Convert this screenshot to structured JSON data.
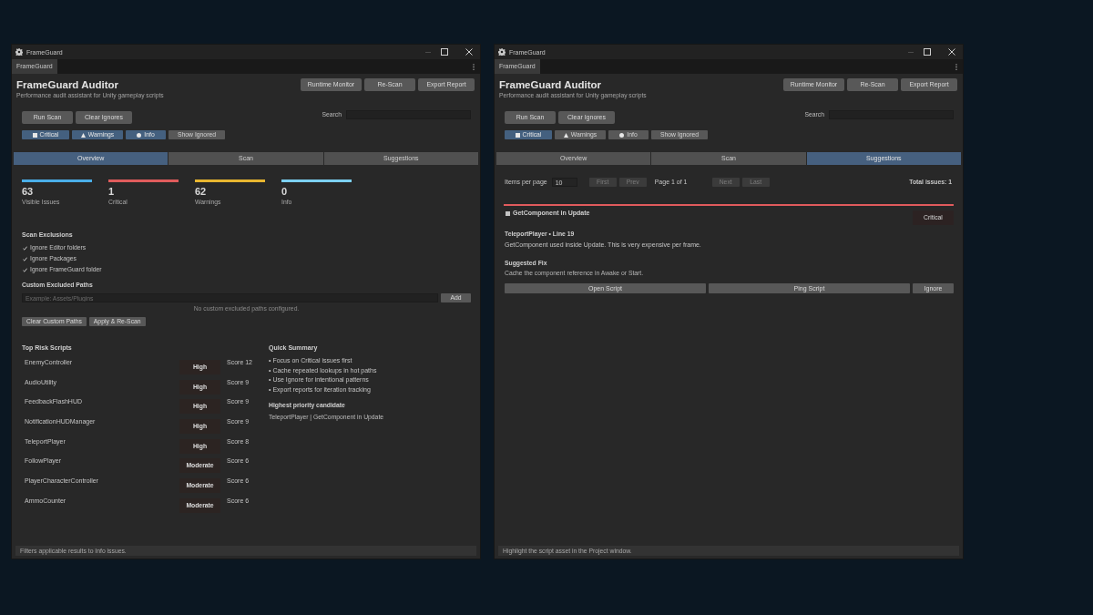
{
  "windows": [
    {
      "title": "FrameGuard",
      "tab": "FrameGuard",
      "header": {
        "title": "FrameGuard Auditor",
        "subtitle": "Performance audit assistant for Unity gameplay scripts",
        "buttons": [
          "Runtime Monitor",
          "Re-Scan",
          "Export Report"
        ]
      },
      "toolbar": {
        "buttons": [
          "Run Scan",
          "Clear Ignores"
        ],
        "search_label": "Search"
      },
      "filters": [
        {
          "kind": "critical",
          "label": "Critical",
          "selected": true
        },
        {
          "kind": "warning",
          "label": "Warnings",
          "selected": true
        },
        {
          "kind": "info",
          "label": "Info",
          "selected": true
        },
        {
          "kind": "plain",
          "label": "Show Ignored",
          "selected": false
        }
      ],
      "tabs": [
        {
          "label": "Overview",
          "selected": true
        },
        {
          "label": "Scan",
          "selected": false
        },
        {
          "label": "Suggestions",
          "selected": false
        }
      ],
      "content": {
        "kind": "overview",
        "stats": [
          {
            "value": "63",
            "label": "Visible Issues",
            "color": "#4aaee8"
          },
          {
            "value": "1",
            "label": "Critical",
            "color": "#e05c5c"
          },
          {
            "value": "62",
            "label": "Warnings",
            "color": "#e8b630"
          },
          {
            "value": "0",
            "label": "Info",
            "color": "#7cd0f2"
          }
        ],
        "exclusions": {
          "title": "Scan Exclusions",
          "options": [
            {
              "label": "Ignore Editor folders",
              "checked": true
            },
            {
              "label": "Ignore Packages",
              "checked": true
            },
            {
              "label": "Ignore FrameGuard folder",
              "checked": true
            }
          ]
        },
        "custom_paths": {
          "title": "Custom Excluded Paths",
          "placeholder": "Example: Assets/Plugins",
          "add_button": "Add",
          "empty_message": "No custom excluded paths configured.",
          "buttons": [
            "Clear Custom Paths",
            "Apply & Re-Scan"
          ]
        },
        "top_risk": {
          "title": "Top Risk Scripts",
          "rows": [
            {
              "name": "EnemyController",
              "risk": "High",
              "score": "Score 12"
            },
            {
              "name": "AudioUtility",
              "risk": "High",
              "score": "Score 9"
            },
            {
              "name": "FeedbackFlashHUD",
              "risk": "High",
              "score": "Score 9"
            },
            {
              "name": "NotificationHUDManager",
              "risk": "High",
              "score": "Score 9"
            },
            {
              "name": "TeleportPlayer",
              "risk": "High",
              "score": "Score 8"
            },
            {
              "name": "FollowPlayer",
              "risk": "Moderate",
              "score": "Score 6"
            },
            {
              "name": "PlayerCharacterController",
              "risk": "Moderate",
              "score": "Score 6"
            },
            {
              "name": "AmmoCounter",
              "risk": "Moderate",
              "score": "Score 6"
            }
          ]
        },
        "summary": {
          "title": "Quick Summary",
          "bullets": [
            "• Focus on Critical issues first",
            "• Cache repeated lookups in hot paths",
            "• Use Ignore for intentional patterns",
            "• Export reports for iteration tracking"
          ],
          "candidate_label": "Highest priority candidate",
          "candidate": "TeleportPlayer | GetComponent in Update"
        }
      },
      "status_bar": "Filters applicable results to Info issues."
    },
    {
      "title": "FrameGuard",
      "tab": "FrameGuard",
      "header": {
        "title": "FrameGuard Auditor",
        "subtitle": "Performance audit assistant for Unity gameplay scripts",
        "buttons": [
          "Runtime Monitor",
          "Re-Scan",
          "Export Report"
        ]
      },
      "toolbar": {
        "buttons": [
          "Run Scan",
          "Clear Ignores"
        ],
        "search_label": "Search"
      },
      "filters": [
        {
          "kind": "critical",
          "label": "Critical",
          "selected": true
        },
        {
          "kind": "warning",
          "label": "Warnings",
          "selected": false
        },
        {
          "kind": "info",
          "label": "Info",
          "selected": false
        },
        {
          "kind": "plain",
          "label": "Show Ignored",
          "selected": false
        }
      ],
      "tabs": [
        {
          "label": "Overview",
          "selected": false
        },
        {
          "label": "Scan",
          "selected": false
        },
        {
          "label": "Suggestions",
          "selected": true
        }
      ],
      "content": {
        "kind": "suggestions",
        "pager": {
          "label": "Items per page",
          "value": "10",
          "back": [
            {
              "label": "First",
              "disabled": true
            },
            {
              "label": "Prev",
              "disabled": true
            }
          ],
          "page": "Page 1 of 1",
          "forward": [
            {
              "label": "Next",
              "disabled": true
            },
            {
              "label": "Last",
              "disabled": true
            }
          ],
          "total": "Total issues: 1"
        },
        "issues": [
          {
            "kind": "critical",
            "checked": false,
            "title": "GetComponent in Update",
            "severity": "Critical",
            "location": "TeleportPlayer • Line 19",
            "description": "GetComponent used inside Update. This is very expensive per frame.",
            "fix_title": "Suggested Fix",
            "fix": "Cache the component reference in Awake or Start.",
            "actions": [
              "Open Script",
              "Ping Script",
              "Ignore"
            ]
          }
        ]
      },
      "status_bar": "Highlight the script asset in the Project window."
    }
  ]
}
